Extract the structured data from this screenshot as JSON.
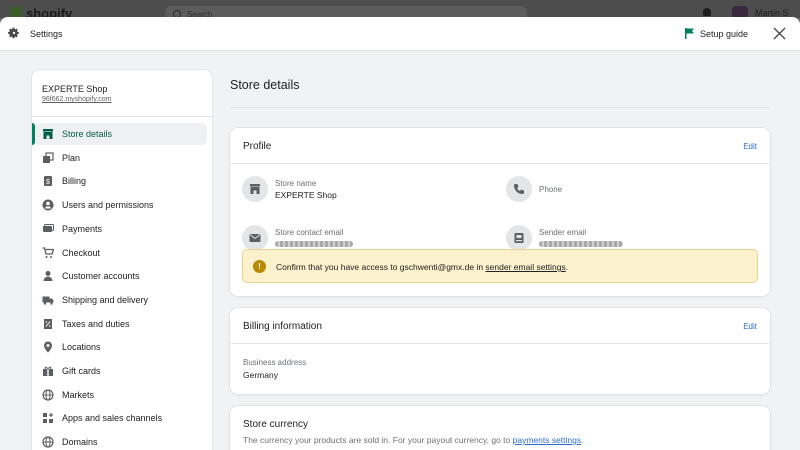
{
  "background": {
    "logo_text": "shopify",
    "search_placeholder": "Search",
    "user_name": "Martin S"
  },
  "header": {
    "title": "Settings",
    "setup_guide_label": "Setup guide"
  },
  "sidebar": {
    "shop_name": "EXPERTE Shop",
    "shop_url": "96f662.myshopify.com",
    "items": [
      {
        "label": "Store details",
        "icon": "store-icon",
        "active": true
      },
      {
        "label": "Plan",
        "icon": "plan-icon"
      },
      {
        "label": "Billing",
        "icon": "billing-icon"
      },
      {
        "label": "Users and permissions",
        "icon": "user-circle-icon"
      },
      {
        "label": "Payments",
        "icon": "payments-icon"
      },
      {
        "label": "Checkout",
        "icon": "cart-icon"
      },
      {
        "label": "Customer accounts",
        "icon": "customer-icon"
      },
      {
        "label": "Shipping and delivery",
        "icon": "truck-icon"
      },
      {
        "label": "Taxes and duties",
        "icon": "tax-icon"
      },
      {
        "label": "Locations",
        "icon": "location-pin-icon"
      },
      {
        "label": "Gift cards",
        "icon": "gift-icon"
      },
      {
        "label": "Markets",
        "icon": "globe-icon"
      },
      {
        "label": "Apps and sales channels",
        "icon": "apps-icon"
      },
      {
        "label": "Domains",
        "icon": "globe-icon"
      }
    ]
  },
  "main": {
    "page_title": "Store details",
    "profile": {
      "title": "Profile",
      "edit_label": "Edit",
      "store_name_label": "Store name",
      "store_name_value": "EXPERTE Shop",
      "phone_label": "Phone",
      "contact_email_label": "Store contact email",
      "sender_email_label": "Sender email",
      "banner_text": "Confirm that you have access to gschwenti@gmx.de in ",
      "banner_link": "sender email settings",
      "banner_suffix": "."
    },
    "billing": {
      "title": "Billing information",
      "edit_label": "Edit",
      "address_label": "Business address",
      "address_value": "Germany"
    },
    "currency": {
      "title": "Store currency",
      "description": "The currency your products are sold in. For your payout currency, go to ",
      "link": "payments settings",
      "suffix": "."
    }
  }
}
